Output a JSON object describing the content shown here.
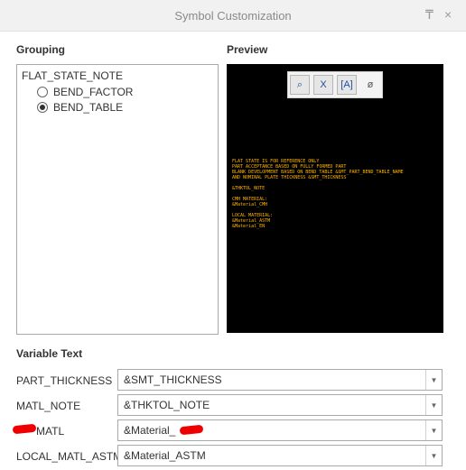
{
  "window": {
    "title": "Symbol Customization",
    "pin_icon": "pin-icon",
    "close_icon": "close-icon",
    "pin_glyph": "₸",
    "close_glyph": "×"
  },
  "grouping": {
    "heading": "Grouping",
    "root": "FLAT_STATE_NOTE",
    "options": [
      {
        "label": "BEND_FACTOR",
        "checked": false
      },
      {
        "label": "BEND_TABLE",
        "checked": true
      }
    ]
  },
  "preview": {
    "heading": "Preview",
    "toolbar": [
      {
        "icon": "zoom-icon",
        "glyph": "⌕"
      },
      {
        "icon": "text-style-icon",
        "glyph": "X"
      },
      {
        "icon": "bracket-text-icon",
        "glyph": "[A]"
      },
      {
        "icon": "text-direction-icon",
        "glyph": "ø"
      }
    ],
    "note_lines": "FLAT STATE IS FOR REFERENCE ONLY\nPART ACCEPTANCE BASED ON FULLY FORMED PART\nBLANK DEVELOPMENT BASED ON BEND TABLE &SMT_PART_BEND_TABLE_NAME\nAND NOMINAL PLATE THICKNESS &SMT_THICKNESS\n\n&THKTOL_NOTE\n\nCMH MATERIAL:\n&Material_CMH\n\nLOCAL MATERIAL:\n&Material_ASTM\n&Material_EN"
  },
  "variable_text": {
    "heading": "Variable Text",
    "rows": [
      {
        "label": "PART_THICKNESS",
        "value": "&SMT_THICKNESS"
      },
      {
        "label": "MATL_NOTE",
        "value": "&THKTOL_NOTE"
      },
      {
        "label": "MATL",
        "value": "&Material_"
      },
      {
        "label": "LOCAL_MATL_ASTM",
        "value": "&Material_ASTM"
      }
    ],
    "dropdown_glyph": "▼"
  },
  "colors": {
    "note_text": "#ffb400",
    "redaction": "#e00000"
  }
}
